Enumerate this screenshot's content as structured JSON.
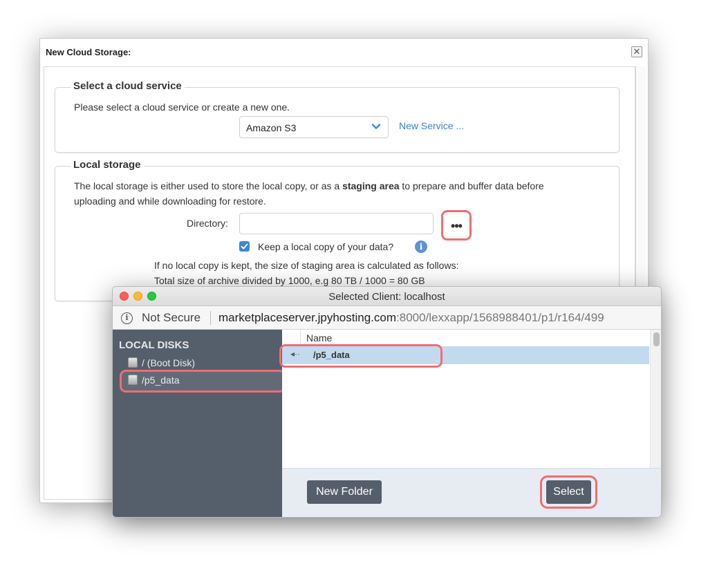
{
  "dialog": {
    "title": "New Cloud Storage:",
    "close_label": "✕",
    "cloud_group": {
      "legend": "Select a cloud service",
      "prompt": "Please select a cloud service or create a new one.",
      "selected_service": "Amazon S3",
      "new_service_link": "New Service ..."
    },
    "local_group": {
      "legend": "Local storage",
      "desc_part1": "The local storage is either used to store the local copy, or as a ",
      "desc_bold": "staging area",
      "desc_part2": " to prepare and buffer data before",
      "desc_line2": "uploading and while downloading for restore.",
      "directory_label": "Directory:",
      "directory_value": "",
      "browse_label": "•••",
      "keep_copy_label": "Keep a local copy of your data?",
      "keep_copy_checked": true,
      "info_label": "i",
      "note_line1": "If no local copy is kept, the size of staging area is calculated as follows:",
      "note_line2": "Total size of archive divided by 1000, e.g 80 TB / 1000 = 80 GB"
    }
  },
  "browser_window": {
    "title": "Selected Client: localhost",
    "url": {
      "info_icon": "i",
      "security_label": "Not Secure",
      "host": "marketplaceserver.jpyhosting.com",
      "path": ":8000/lexxapp/1568988401/p1/r164/499"
    },
    "sidebar": {
      "heading": "LOCAL DISKS",
      "items": [
        {
          "label": "/ (Boot Disk)",
          "icon": "disk-icon"
        },
        {
          "label": "/p5_data",
          "icon": "disk-icon",
          "selected": true
        }
      ]
    },
    "list": {
      "column_name": "Name",
      "rows": [
        {
          "label": "/p5_data",
          "icon": "back-arrow-icon",
          "selected": true
        }
      ]
    },
    "footer": {
      "new_folder_label": "New Folder",
      "select_label": "Select"
    }
  },
  "colors": {
    "highlight": "#f06d72",
    "sidebar_bg": "#555e6b",
    "link": "#3a83d1",
    "selection": "#c3d9ee"
  }
}
